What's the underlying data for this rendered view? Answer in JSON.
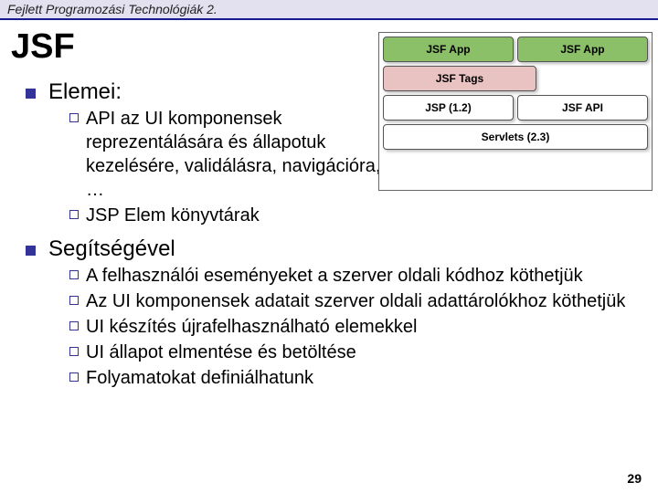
{
  "header": {
    "course": "Fejlett Programozási Technológiák 2."
  },
  "title": "JSF",
  "sections": {
    "a": {
      "heading": "Elemei:",
      "items": [
        "API az UI komponensek reprezentálására és állapotuk kezelésére, validálásra, navigációra, …",
        "JSP Elem könyvtárak"
      ]
    },
    "b": {
      "heading": "Segítségével",
      "items": [
        "A felhasználói eseményeket a szerver oldali kódhoz köthetjük",
        "Az UI komponensek adatait szerver oldali adattárolókhoz köthetjük",
        "UI készítés újrafelhasználható elemekkel",
        "UI állapot elmentése és betöltése",
        "Folyamatokat definiálhatunk"
      ]
    }
  },
  "diagram": {
    "top_left": "JSF App",
    "top_right": "JSF App",
    "tags": "JSF Tags",
    "jsp": "JSP (1.2)",
    "api": "JSF API",
    "servlets": "Servlets (2.3)"
  },
  "page_number": "29"
}
